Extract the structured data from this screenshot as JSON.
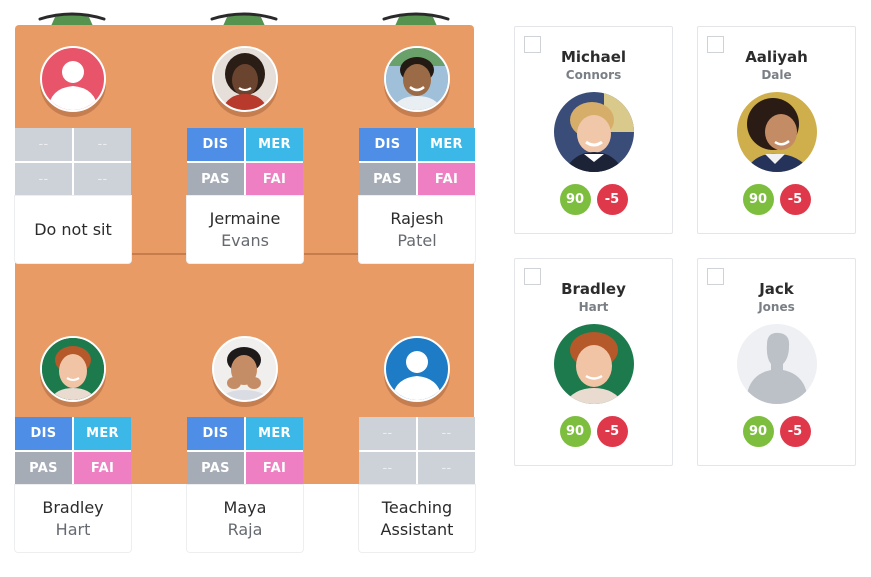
{
  "colors": {
    "room": "#E99B66",
    "dis": "#4E8EE6",
    "mer": "#3BB8E8",
    "pas": "#A6ACB6",
    "fai": "#EE7FC2",
    "empty": "#CDD1D8",
    "positive": "#7DBE3F",
    "negative": "#E0384B"
  },
  "lamps": [
    {
      "icon": "lamp-icon"
    },
    {
      "icon": "lamp-icon"
    },
    {
      "icon": "lamp-icon"
    }
  ],
  "seats": [
    {
      "row": 1,
      "col": 1,
      "avatar": "placeholder-red",
      "first": "Do not sit",
      "last": "",
      "grid": [
        "--",
        "--",
        "--",
        "--"
      ],
      "empty": true
    },
    {
      "row": 1,
      "col": 2,
      "avatar": "photo",
      "first": "Jermaine",
      "last": "Evans",
      "grid": [
        "DIS",
        "MER",
        "PAS",
        "FAI"
      ],
      "empty": false
    },
    {
      "row": 1,
      "col": 3,
      "avatar": "photo",
      "first": "Rajesh",
      "last": "Patel",
      "grid": [
        "DIS",
        "MER",
        "PAS",
        "FAI"
      ],
      "empty": false
    },
    {
      "row": 2,
      "col": 1,
      "avatar": "photo",
      "first": "Bradley",
      "last": "Hart",
      "grid": [
        "DIS",
        "MER",
        "PAS",
        "FAI"
      ],
      "empty": false
    },
    {
      "row": 2,
      "col": 2,
      "avatar": "photo",
      "first": "Maya",
      "last": "Raja",
      "grid": [
        "DIS",
        "MER",
        "PAS",
        "FAI"
      ],
      "empty": false
    },
    {
      "row": 2,
      "col": 3,
      "avatar": "placeholder-blue",
      "first": "Teaching",
      "last": "Assistant",
      "grid": [
        "--",
        "--",
        "--",
        "--"
      ],
      "empty": true
    }
  ],
  "students": [
    {
      "first": "Michael",
      "last": "Connors",
      "positive": "90",
      "negative": "-5",
      "checked": false,
      "avatar": "photo"
    },
    {
      "first": "Aaliyah",
      "last": "Dale",
      "positive": "90",
      "negative": "-5",
      "checked": false,
      "avatar": "photo"
    },
    {
      "first": "Bradley",
      "last": "Hart",
      "positive": "90",
      "negative": "-5",
      "checked": false,
      "avatar": "photo"
    },
    {
      "first": "Jack",
      "last": "Jones",
      "positive": "90",
      "negative": "-5",
      "checked": false,
      "avatar": "placeholder-gray"
    }
  ]
}
